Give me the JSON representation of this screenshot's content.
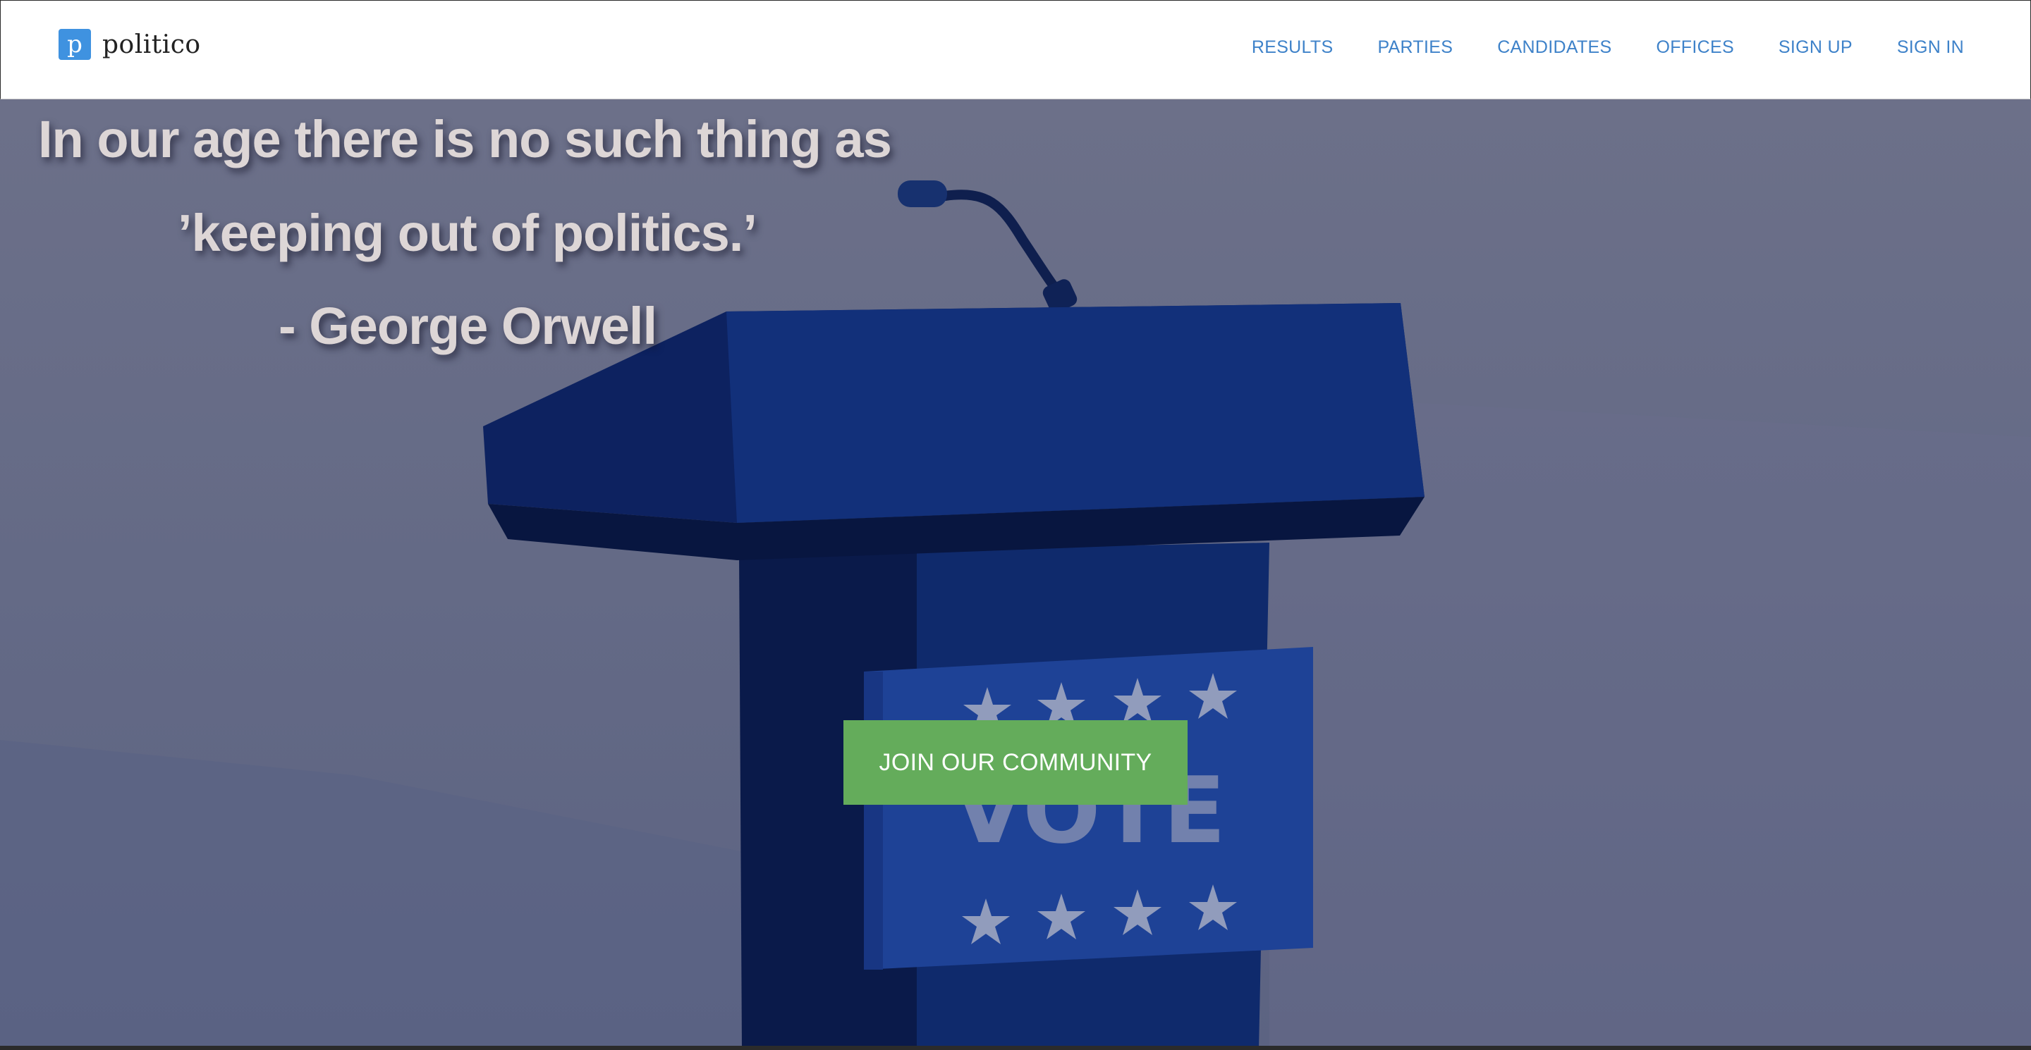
{
  "header": {
    "logo_letter": "p",
    "brand_name": "politico",
    "logo_color": "#3f92e0",
    "nav": [
      {
        "label": "RESULTS"
      },
      {
        "label": "PARTIES"
      },
      {
        "label": "CANDIDATES"
      },
      {
        "label": "OFFICES"
      },
      {
        "label": "SIGN UP"
      },
      {
        "label": "SIGN IN"
      }
    ],
    "nav_color": "#3e82c9"
  },
  "hero": {
    "quote_lines": [
      "In our age there is no such thing as",
      "’keeping out of politics.’",
      "- George Orwell"
    ],
    "podium_sign_text": "VOTE",
    "cta_label": "JOIN OUR COMMUNITY",
    "cta_color": "#64ac5b"
  }
}
